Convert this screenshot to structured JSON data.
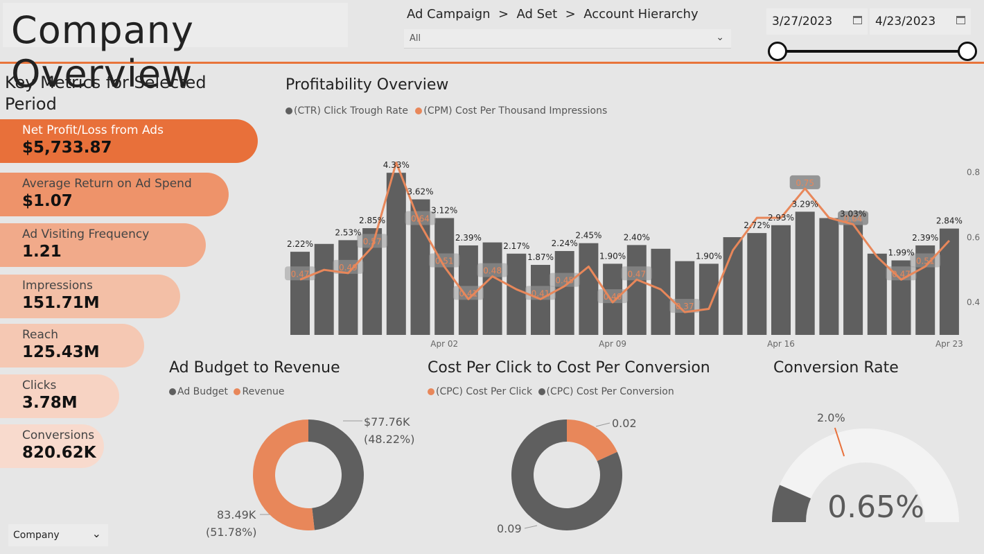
{
  "header": {
    "title": "Company Overview",
    "slicer_label": "Ad Campaign  >  Ad Set  >  Account Hierarchy",
    "slicer_value": "All",
    "start_date": "3/27/2023",
    "end_date": "4/23/2023"
  },
  "key_metrics": {
    "title": "Key Metrics for Selected Period",
    "items": [
      {
        "label": "Net Profit/Loss from Ads",
        "value": "$5,733.87",
        "color": "#e8703a"
      },
      {
        "label": "Average Return on Ad Spend",
        "value": "$1.07",
        "color": "#ee936a"
      },
      {
        "label": "Ad Visiting Frequency",
        "value": "1.21",
        "color": "#f1aa8a"
      },
      {
        "label": "Impressions",
        "value": "151.71M",
        "color": "#f3bfa6"
      },
      {
        "label": "Reach",
        "value": "125.43M",
        "color": "#f5c8b3"
      },
      {
        "label": "Clicks",
        "value": "3.78M",
        "color": "#f7d3c3"
      },
      {
        "label": "Conversions",
        "value": "820.62K",
        "color": "#f8dacd"
      }
    ]
  },
  "company_filter": {
    "value": "Company"
  },
  "profitability": {
    "title": "Profitability Overview",
    "legend": [
      "(CTR) Click Trough Rate",
      "(CPM) Cost Per Thousand Impressions"
    ],
    "colors": {
      "ctr": "#5f5f5f",
      "cpm": "#e8875a"
    }
  },
  "budget": {
    "title": "Ad Budget to Revenue",
    "legend": [
      "Ad Budget",
      "Revenue"
    ],
    "label_budget_1": "$77.76K",
    "label_budget_2": "(48.22%)",
    "label_revenue_1": "83.49K",
    "label_revenue_2": "(51.78%)"
  },
  "cpc": {
    "title": "Cost Per Click to Cost Per Conversion",
    "legend": [
      "(CPC) Cost Per Click",
      "(CPC) Cost Per Conversion"
    ],
    "label_click": "0.02",
    "label_conversion": "0.09"
  },
  "conversion": {
    "title": "Conversion Rate",
    "target_label": "2.0%",
    "value_label": "0.65%"
  },
  "chart_data": [
    {
      "type": "bar",
      "title": "Profitability Overview",
      "x_tick_labels": [
        "Apr 02",
        "Apr 09",
        "Apr 16",
        "Apr 23"
      ],
      "x": [
        "Mar 27",
        "Mar 28",
        "Mar 29",
        "Mar 30",
        "Mar 31",
        "Apr 01",
        "Apr 02",
        "Apr 03",
        "Apr 04",
        "Apr 05",
        "Apr 06",
        "Apr 07",
        "Apr 08",
        "Apr 09",
        "Apr 10",
        "Apr 11",
        "Apr 12",
        "Apr 13",
        "Apr 14",
        "Apr 15",
        "Apr 16",
        "Apr 17",
        "Apr 18",
        "Apr 19",
        "Apr 20",
        "Apr 21",
        "Apr 22",
        "Apr 23"
      ],
      "series": [
        {
          "name": "(CTR) Click Trough Rate",
          "type": "bar",
          "values": [
            2.22,
            2.43,
            2.53,
            2.85,
            4.33,
            3.62,
            3.12,
            2.39,
            2.47,
            2.17,
            1.87,
            2.24,
            2.45,
            1.9,
            2.4,
            2.3,
            1.97,
            1.9,
            2.61,
            2.72,
            2.93,
            3.29,
            3.12,
            3.03,
            2.17,
            1.99,
            2.39,
            2.84
          ],
          "labels": [
            "2.22%",
            "",
            "2.53%",
            "2.85%",
            "4.33%",
            "3.62%",
            "3.12%",
            "2.39%",
            "",
            "2.17%",
            "1.87%",
            "2.24%",
            "2.45%",
            "1.90%",
            "2.40%",
            "",
            "",
            "1.90%",
            "",
            "2.72%",
            "2.93%",
            "3.29%",
            "",
            "3.03%",
            "",
            "1.99%",
            "2.39%",
            "2.84%"
          ]
        },
        {
          "name": "(CPM) Cost Per Thousand Impressions",
          "type": "line",
          "values": [
            0.47,
            0.5,
            0.49,
            0.57,
            0.83,
            0.64,
            0.51,
            0.41,
            0.48,
            0.44,
            0.41,
            0.45,
            0.51,
            0.4,
            0.47,
            0.44,
            0.37,
            0.38,
            0.56,
            0.66,
            0.66,
            0.75,
            0.66,
            0.64,
            0.54,
            0.47,
            0.51,
            0.59
          ],
          "labels": [
            "0.47",
            "",
            "0.49",
            "0.57",
            "",
            "0.64",
            "0.51",
            "0.41",
            "0.48",
            "",
            "0.41",
            "0.45",
            "",
            "0.40",
            "0.47",
            "",
            "0.37",
            "",
            "",
            "",
            "",
            "0.75",
            "",
            "0.64",
            "",
            "0.47",
            "0.51",
            ""
          ]
        }
      ],
      "y_right_ticks": [
        "0.4",
        "0.6",
        "0.8"
      ],
      "y_right_range": [
        0.3,
        0.85
      ],
      "y_left_range": [
        0,
        5.0
      ]
    },
    {
      "type": "pie",
      "title": "Ad Budget to Revenue",
      "categories": [
        "Ad Budget",
        "Revenue"
      ],
      "values": [
        77.76,
        83.49
      ],
      "percent": [
        48.22,
        51.78
      ],
      "colors": [
        "#5f5f5f",
        "#e8875a"
      ]
    },
    {
      "type": "pie",
      "title": "Cost Per Click to Cost Per Conversion",
      "categories": [
        "(CPC) Cost Per Click",
        "(CPC) Cost Per Conversion"
      ],
      "values": [
        0.02,
        0.09
      ],
      "colors": [
        "#e8875a",
        "#5f5f5f"
      ]
    },
    {
      "type": "gauge",
      "title": "Conversion Rate",
      "value": 0.65,
      "target": 2.0,
      "max": 5.0,
      "colors": {
        "fill": "#5f5f5f",
        "track": "#f3f3f3",
        "target": "#e8703a"
      }
    }
  ]
}
